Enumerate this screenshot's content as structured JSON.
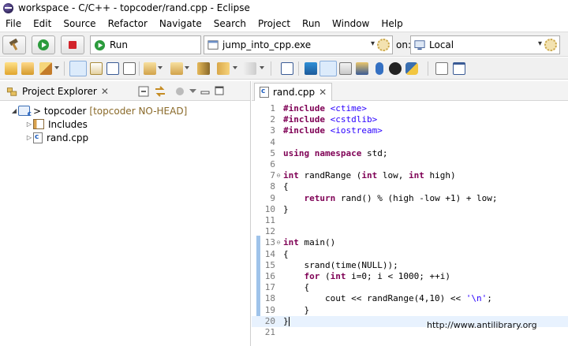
{
  "window": {
    "title": "workspace - C/C++ - topcoder/rand.cpp - Eclipse"
  },
  "menu": [
    "File",
    "Edit",
    "Source",
    "Refactor",
    "Navigate",
    "Search",
    "Project",
    "Run",
    "Window",
    "Help"
  ],
  "toolbar": {
    "run_mode_label": "Run",
    "launch_config": "jump_into_cpp.exe",
    "on_label": "on:",
    "target": "Local"
  },
  "project_explorer": {
    "title": "Project Explorer",
    "tree": [
      {
        "label": "> topcoder",
        "decoration": "[topcoder NO-HEAD]",
        "expanded": true
      },
      {
        "label": "Includes"
      },
      {
        "label": "rand.cpp"
      }
    ]
  },
  "editor": {
    "tab_label": "rand.cpp",
    "lines": [
      {
        "n": "1",
        "text": "#include <ctime>"
      },
      {
        "n": "2",
        "text": "#include <cstdlib>"
      },
      {
        "n": "3",
        "text": "#include <iostream>"
      },
      {
        "n": "4",
        "text": ""
      },
      {
        "n": "5",
        "text": "using namespace std;"
      },
      {
        "n": "6",
        "text": ""
      },
      {
        "n": "7",
        "text": "int randRange (int low, int high)"
      },
      {
        "n": "8",
        "text": "{"
      },
      {
        "n": "9",
        "text": "    return rand() % (high -low +1) + low;"
      },
      {
        "n": "10",
        "text": "}"
      },
      {
        "n": "11",
        "text": ""
      },
      {
        "n": "12",
        "text": ""
      },
      {
        "n": "13",
        "text": "int main()"
      },
      {
        "n": "14",
        "text": "{"
      },
      {
        "n": "15",
        "text": "    srand(time(NULL));"
      },
      {
        "n": "16",
        "text": "    for (int i=0; i < 1000; ++i)"
      },
      {
        "n": "17",
        "text": "    {"
      },
      {
        "n": "18",
        "text": "        cout << randRange(4,10) << '\\n';"
      },
      {
        "n": "19",
        "text": "    }"
      },
      {
        "n": "20",
        "text": "}"
      },
      {
        "n": "21",
        "text": ""
      }
    ]
  },
  "watermark": "http://www.antilibrary.org"
}
